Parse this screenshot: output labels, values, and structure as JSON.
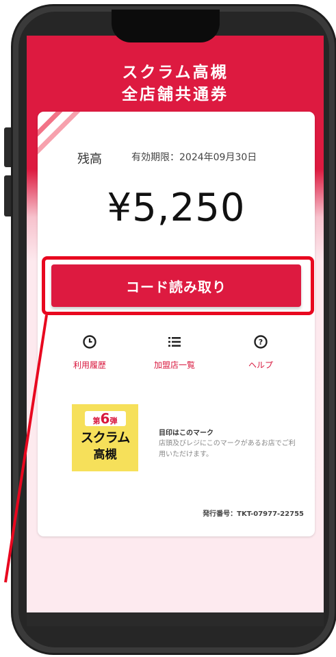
{
  "header": {
    "title_line1": "スクラム高槻",
    "title_line2": "全店舗共通券"
  },
  "card": {
    "balance_label": "残高",
    "expiry": "有効期限：2024年09月30日",
    "amount": "¥5,250",
    "read_button": "コード読み取り"
  },
  "menu": [
    {
      "label": "利用履歴",
      "icon": "clock-icon"
    },
    {
      "label": "加盟店一覧",
      "icon": "list-icon"
    },
    {
      "label": "ヘルプ",
      "icon": "help-icon"
    }
  ],
  "mark": {
    "logo_prefix": "第",
    "logo_number": "6",
    "logo_suffix": "弾",
    "logo_line1": "スクラム",
    "logo_line2": "高槻",
    "title": "目印はこのマーク",
    "description": "店頭及びレジにこのマークがあるお店でご利用いただけます。"
  },
  "issue_number": "発行番号：TKT-07977-22755",
  "colors": {
    "brand_red": "#dd1a40",
    "annotation_red": "#e8071f",
    "logo_yellow": "#f6e05a"
  }
}
